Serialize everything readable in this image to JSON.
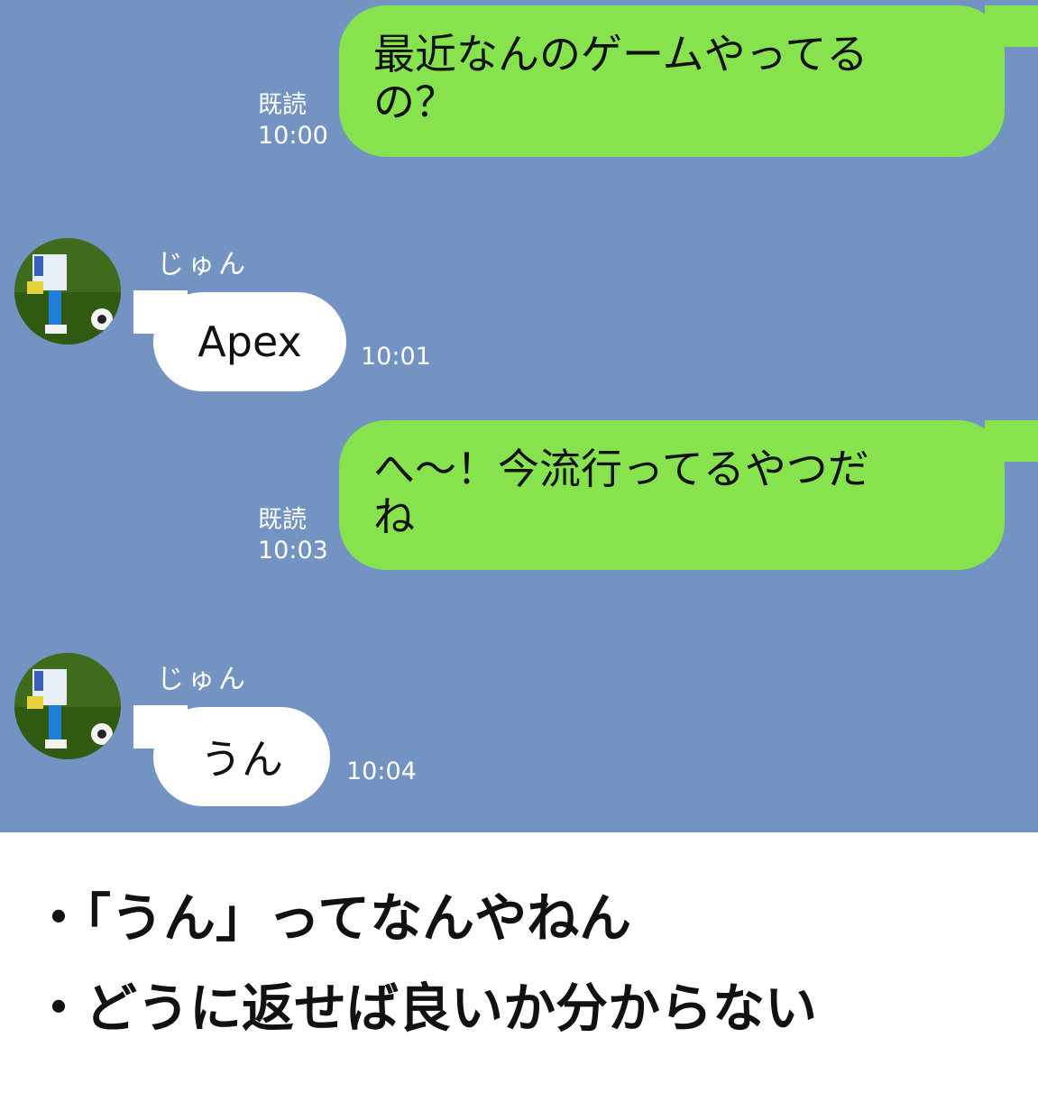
{
  "chat": {
    "messages": [
      {
        "side": "out",
        "text": "最近なんのゲームやってるの？",
        "line1": "最近なんのゲームやってる",
        "line2": "の？",
        "read": "既読",
        "time": "10:00"
      },
      {
        "side": "in",
        "sender": "じゅん",
        "text": "Apex",
        "time": "10:01"
      },
      {
        "side": "out",
        "text": "へ～！今流行ってるやつだね",
        "line1": "へ～！今流行ってるやつだ",
        "line2": "ね",
        "read": "既読",
        "time": "10:03"
      },
      {
        "side": "in",
        "sender": "じゅん",
        "text": "うん",
        "time": "10:04"
      }
    ]
  },
  "notes": {
    "items": [
      {
        "bullet": "・",
        "text": "「うん」ってなんやねん"
      },
      {
        "bullet": "・",
        "text": "どうに返せば良いか分からない"
      }
    ]
  },
  "colors": {
    "chat_background": "#7393c2",
    "outgoing_bubble": "#86e34d",
    "incoming_bubble": "#ffffff"
  }
}
